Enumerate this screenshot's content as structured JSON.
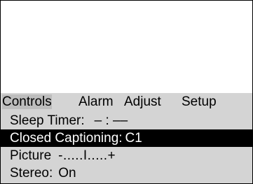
{
  "menu": {
    "tabs": [
      {
        "label": "Controls",
        "active": true
      },
      {
        "label": "Alarm",
        "active": false
      },
      {
        "label": "Adjust",
        "active": false
      },
      {
        "label": "Setup",
        "active": false
      }
    ],
    "items": [
      {
        "label": "Sleep Timer:",
        "value": "– : ––",
        "selected": false
      },
      {
        "label": "Closed Captioning:",
        "value": "C1",
        "selected": true
      },
      {
        "label": "Picture",
        "value": "-.....I.....+",
        "selected": false
      },
      {
        "label": "Stereo:",
        "value": "On",
        "selected": false
      }
    ]
  },
  "colors": {
    "menu_background": "#d4d4d4",
    "active_tab_background": "#bdbdbd",
    "selected_row_background": "#000000",
    "selected_row_text": "#ffffff",
    "screen_background": "#ffffff",
    "border": "#000000"
  }
}
